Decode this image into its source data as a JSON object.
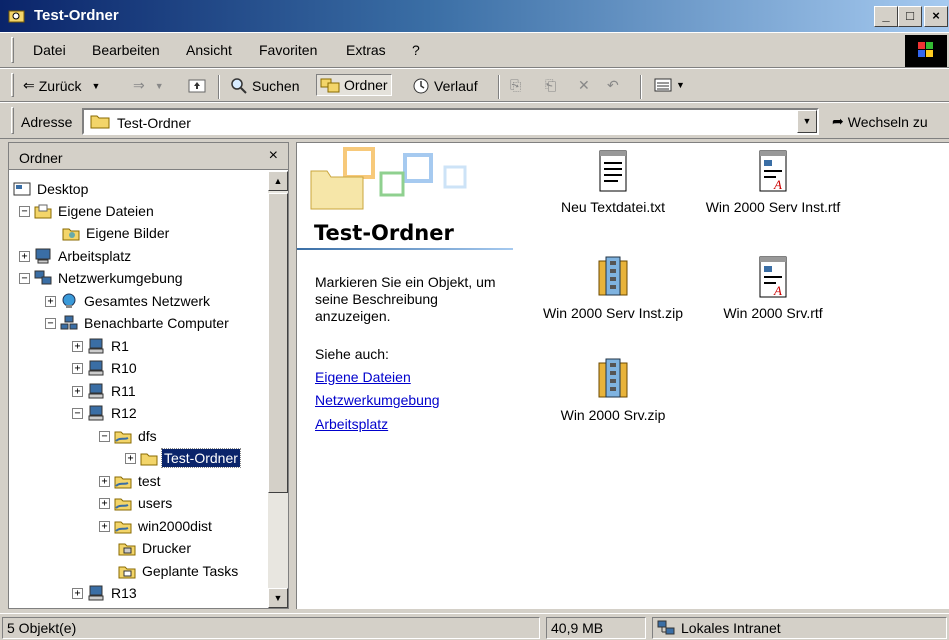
{
  "window": {
    "title": "Test-Ordner",
    "min": "_",
    "max": "□",
    "close": "×"
  },
  "menu": [
    "Datei",
    "Bearbeiten",
    "Ansicht",
    "Favoriten",
    "Extras",
    "?"
  ],
  "toolbar": {
    "back": "Zurück",
    "search": "Suchen",
    "folders": "Ordner",
    "history": "Verlauf"
  },
  "address": {
    "label": "Adresse",
    "value": "Test-Ordner",
    "go": "Wechseln zu"
  },
  "folder_pane": {
    "title": "Ordner",
    "close": "×",
    "tree": [
      {
        "label": "Desktop"
      },
      {
        "label": "Eigene Dateien"
      },
      {
        "label": "Eigene Bilder"
      },
      {
        "label": "Arbeitsplatz"
      },
      {
        "label": "Netzwerkumgebung"
      },
      {
        "label": "Gesamtes Netzwerk"
      },
      {
        "label": "Benachbarte Computer"
      },
      {
        "label": "R1"
      },
      {
        "label": "R10"
      },
      {
        "label": "R11"
      },
      {
        "label": "R12"
      },
      {
        "label": "dfs"
      },
      {
        "label": "Test-Ordner"
      },
      {
        "label": "test"
      },
      {
        "label": "users"
      },
      {
        "label": "win2000dist"
      },
      {
        "label": "Drucker"
      },
      {
        "label": "Geplante Tasks"
      },
      {
        "label": "R13"
      }
    ]
  },
  "content": {
    "heading": "Test-Ordner",
    "description": "Markieren Sie ein Objekt, um seine Beschreibung anzuzeigen.",
    "see_also": "Siehe auch:",
    "links": [
      "Eigene Dateien",
      "Netzwerkumgebung",
      "Arbeitsplatz"
    ],
    "files": [
      {
        "name": "Neu Textdatei.txt",
        "icon": "text-file-icon"
      },
      {
        "name": "Win 2000 Serv Inst.rtf",
        "icon": "rtf-file-icon"
      },
      {
        "name": "Win 2000 Serv Inst.zip",
        "icon": "zip-file-icon"
      },
      {
        "name": "Win 2000 Srv.rtf",
        "icon": "rtf-file-icon"
      },
      {
        "name": "Win 2000 Srv.zip",
        "icon": "zip-file-icon"
      }
    ]
  },
  "status": {
    "objects": "5 Objekt(e)",
    "size": "40,9 MB",
    "zone": "Lokales Intranet"
  }
}
